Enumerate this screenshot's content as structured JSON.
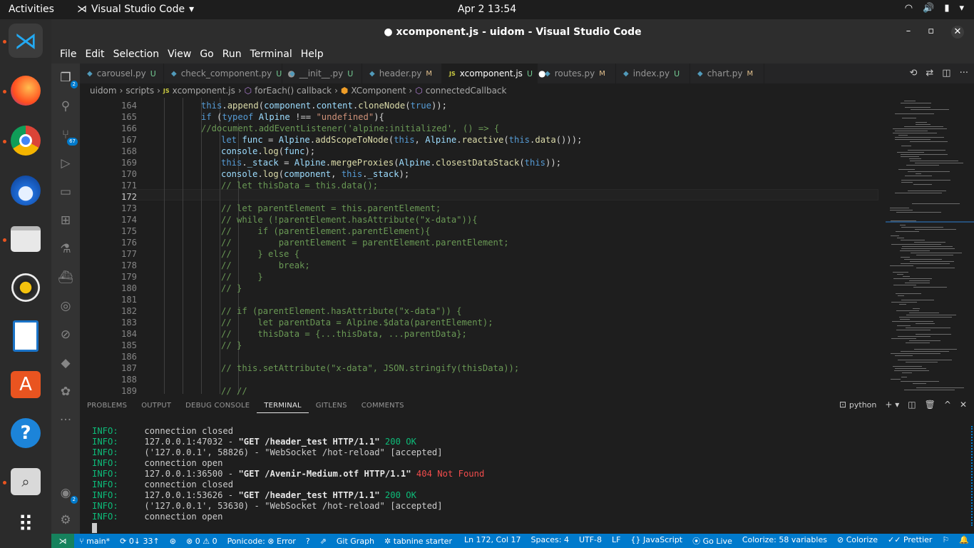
{
  "topbar": {
    "activities": "Activities",
    "app_name": "Visual Studio Code",
    "clock": "Apr 2  13:54"
  },
  "dock": {
    "items": [
      "vscode-icon",
      "firefox-icon",
      "chrome-icon",
      "thunderbird-icon",
      "files-icon",
      "rhythmbox-icon",
      "writer-icon",
      "software-icon",
      "help-icon",
      "screenshot-icon",
      "apps-grid-icon"
    ]
  },
  "window": {
    "title": "● xcomponent.js - uidom - Visual Studio Code"
  },
  "menu": [
    "File",
    "Edit",
    "Selection",
    "View",
    "Go",
    "Run",
    "Terminal",
    "Help"
  ],
  "activity_badges": {
    "explorer": "2",
    "source_control": "67",
    "accounts": "2"
  },
  "tabs": [
    {
      "label": "carousel.py",
      "status": "U",
      "lang": "py"
    },
    {
      "label": "check_component.py",
      "status": "U",
      "lang": "py",
      "dirty": "●"
    },
    {
      "label": "__init__.py",
      "status": "U",
      "lang": "py"
    },
    {
      "label": "header.py",
      "status": "M",
      "lang": "py"
    },
    {
      "label": "xcomponent.js",
      "status": "U",
      "lang": "JS",
      "dirty": "●"
    },
    {
      "label": "routes.py",
      "status": "M",
      "lang": "py"
    },
    {
      "label": "index.py",
      "status": "U",
      "lang": "py"
    },
    {
      "label": "chart.py",
      "status": "M",
      "lang": "py"
    }
  ],
  "breadcrumb": [
    "uidom",
    "scripts",
    "xcomponent.js",
    "forEach() callback",
    "XComponent",
    "connectedCallback"
  ],
  "breadcrumb_icons": {
    "file": "JS"
  },
  "editor": {
    "line_numbers": [
      "164",
      "165",
      "166",
      "167",
      "168",
      "169",
      "170",
      "171",
      "172",
      "173",
      "174",
      "175",
      "176",
      "177",
      "178",
      "179",
      "180",
      "181",
      "182",
      "183",
      "184",
      "185",
      "186",
      "187",
      "188",
      "189"
    ],
    "current_line": "172"
  },
  "panel_tabs": [
    "PROBLEMS",
    "OUTPUT",
    "DEBUG CONSOLE",
    "TERMINAL",
    "GITLENS",
    "COMMENTS"
  ],
  "panel_active": "TERMINAL",
  "terminal_name": "python",
  "terminal_lines": [
    {
      "lvl": "INFO:",
      "text": "connection closed"
    },
    {
      "lvl": "INFO:",
      "addr": "127.0.0.1:47032 - ",
      "req": "\"GET /header_test HTTP/1.1\"",
      "code": " 200 OK",
      "cls": "ok"
    },
    {
      "lvl": "INFO:",
      "text": "('127.0.0.1', 58826) - \"WebSocket /hot-reload\" [accepted]"
    },
    {
      "lvl": "INFO:",
      "text": "connection open"
    },
    {
      "lvl": "INFO:",
      "addr": "127.0.0.1:36500 - ",
      "req": "\"GET /Avenir-Medium.otf HTTP/1.1\"",
      "code": " 404 Not Found",
      "cls": "nf"
    },
    {
      "lvl": "INFO:",
      "text": "connection closed"
    },
    {
      "lvl": "INFO:",
      "addr": "127.0.0.1:53626 - ",
      "req": "\"GET /header_test HTTP/1.1\"",
      "code": " 200 OK",
      "cls": "ok"
    },
    {
      "lvl": "INFO:",
      "text": "('127.0.0.1', 53630) - \"WebSocket /hot-reload\" [accepted]"
    },
    {
      "lvl": "INFO:",
      "text": "connection open"
    }
  ],
  "status": {
    "branch": "main*",
    "sync": "0↓ 33↑",
    "errors": "0",
    "warnings": "0",
    "ponicode": "Ponicode: ⊗ Error",
    "gitgraph": "Git Graph",
    "tabnine": "tabnine starter",
    "position": "Ln 172, Col 17",
    "spaces": "Spaces: 4",
    "encoding": "UTF-8",
    "eol": "LF",
    "language": "JavaScript",
    "golive": "Go Live",
    "colorize_vars": "Colorize: 58 variables",
    "colorize": "Colorize",
    "prettier": "Prettier"
  }
}
